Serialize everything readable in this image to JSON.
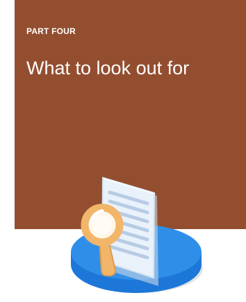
{
  "cover": {
    "eyebrow": "PART FOUR",
    "title": "What to look out for",
    "background_color": "#934e30"
  },
  "illustration": {
    "icon": "document-magnifier-icon",
    "colors": {
      "platform": "#2f8fe8",
      "magnifier": "#f2b66a",
      "document": "#e9f2fb"
    }
  }
}
